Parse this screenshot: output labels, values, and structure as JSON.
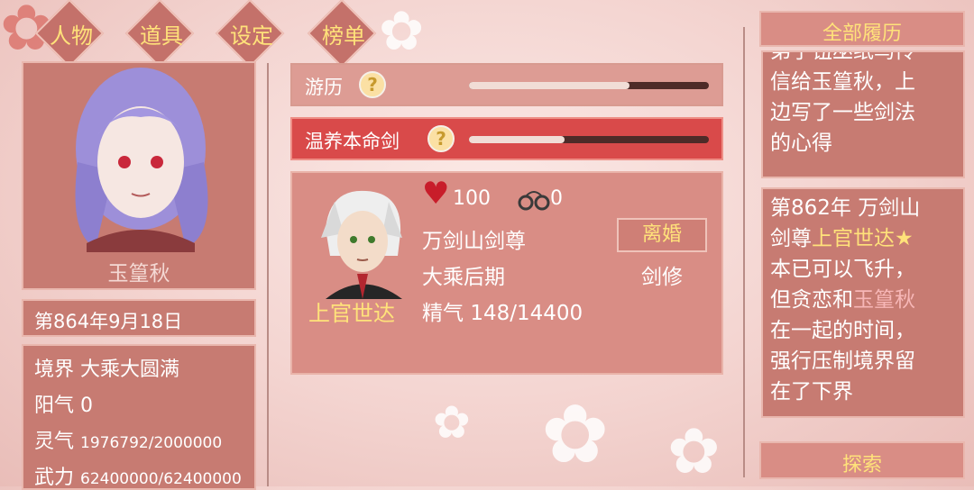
{
  "tabs": [
    "人物",
    "道具",
    "设定",
    "榜单"
  ],
  "player": {
    "name": "玉篁秋",
    "date": "第864年9月18日",
    "stats": [
      {
        "label": "境界",
        "value": "大乘大圆满"
      },
      {
        "label": "阳气",
        "value": "0"
      },
      {
        "label": "灵气",
        "value": "1976792/2000000"
      },
      {
        "label": "武力",
        "value": "62400000/62400000"
      }
    ]
  },
  "activities": [
    {
      "label": "游历",
      "help": "?",
      "progress": 0.67
    },
    {
      "label": "温养本命剑",
      "help": "?",
      "progress": 0.4
    }
  ],
  "partner": {
    "name": "上官世达",
    "affection": "100",
    "handcuffs": "0",
    "title": "万剑山剑尊",
    "realm": "大乘后期",
    "essence_label": "精气",
    "essence": "148/14400",
    "action_button": "离婚",
    "class": "剑修"
  },
  "history": {
    "header": "全部履历",
    "entry1_lines": [
      "弟子钮巫纸鸟传",
      "信给玉篁秋，上",
      "边写了一些剑法",
      "的心得"
    ],
    "entry2": {
      "line1": "第862年 万剑山",
      "line2_pre": "剑尊",
      "line2_name": "上官世达",
      "line2_star": "★",
      "line3": "本已可以飞升，",
      "line4_pre": "但贪恋和",
      "line4_name": "玉篁秋",
      "line5": "在一起的时间，",
      "line6": "强行压制境界留",
      "line7": "在了下界"
    },
    "explore_button": "探索"
  },
  "colors": {
    "accent": "#c77b72",
    "highlight": "#ffe27a",
    "active_row": "#d94a4a"
  }
}
